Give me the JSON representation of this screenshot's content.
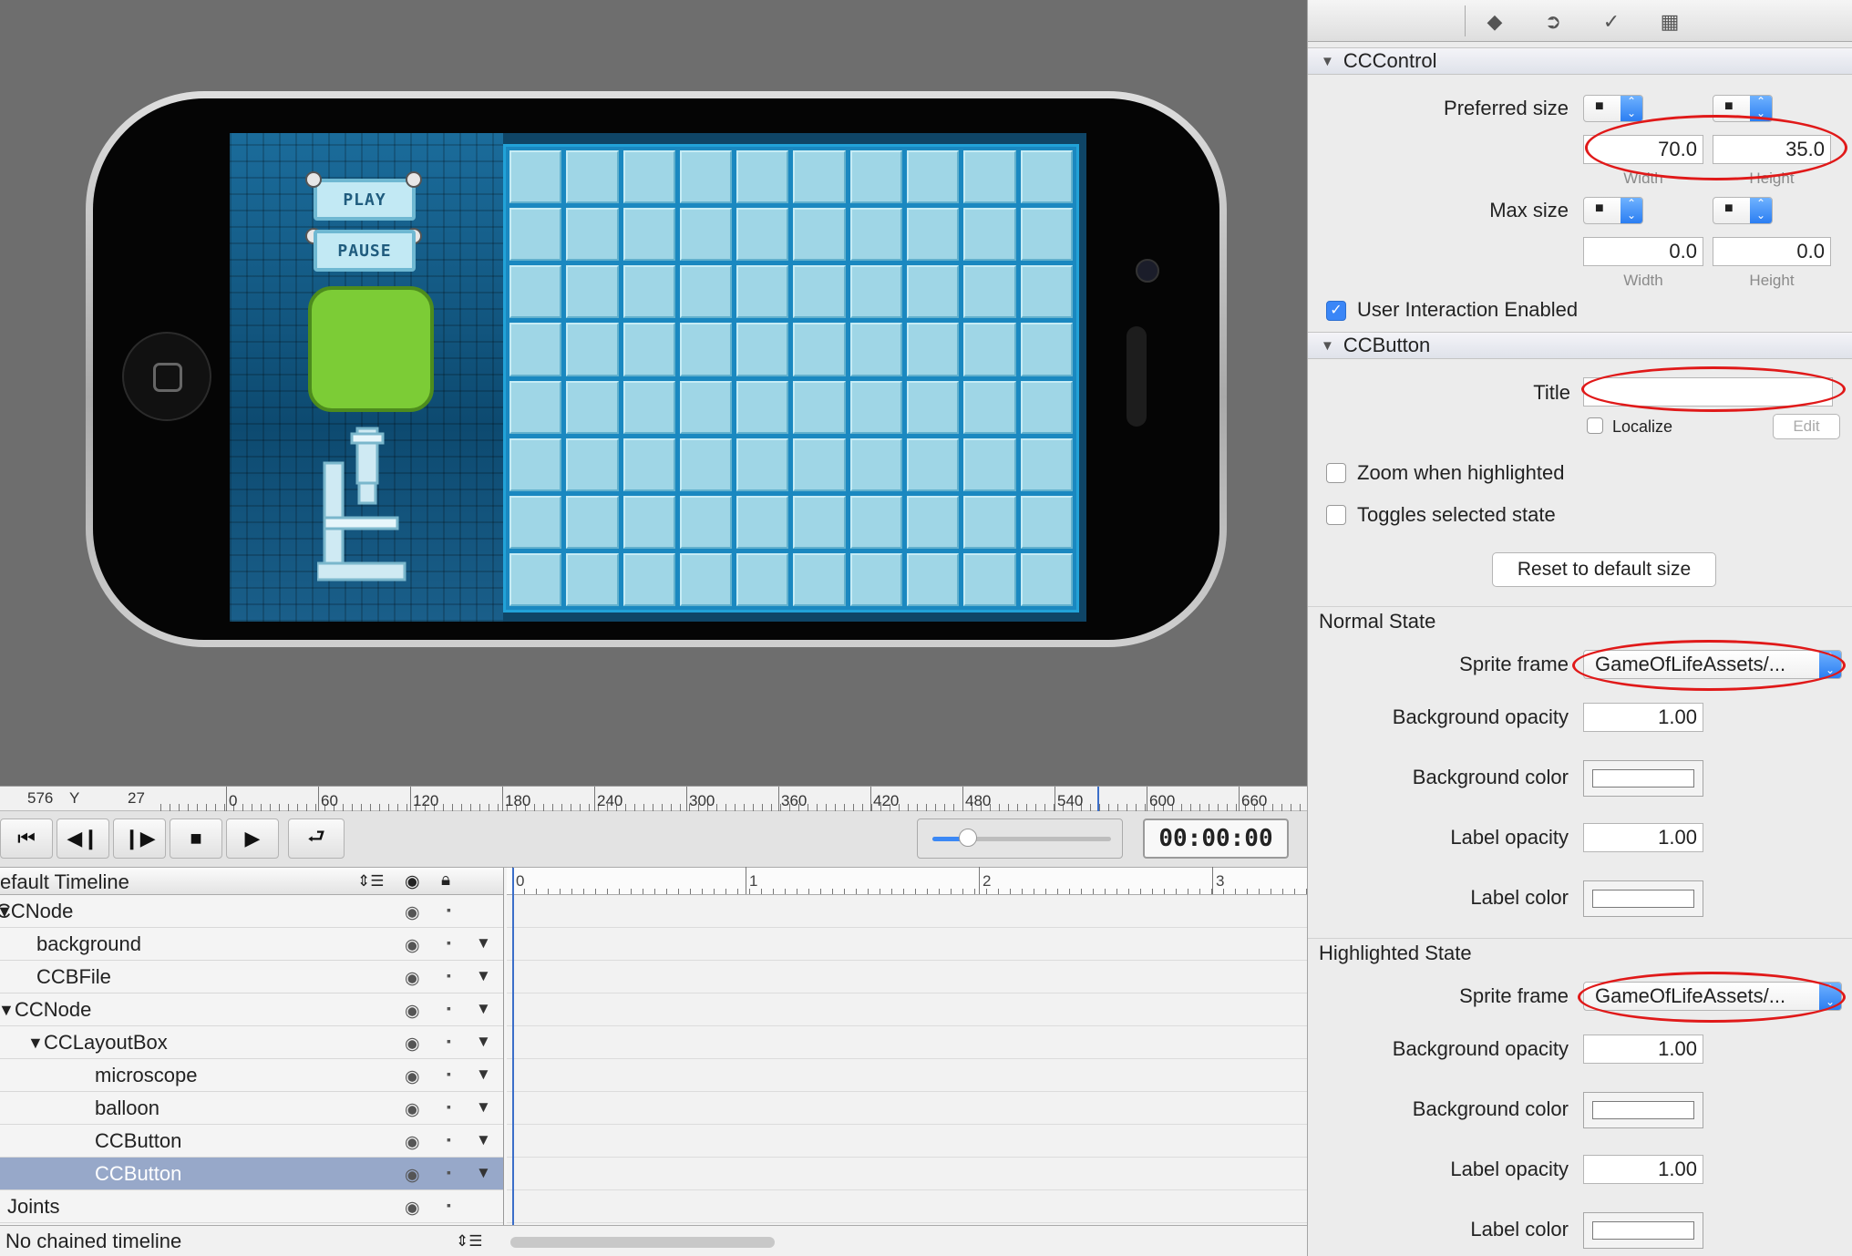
{
  "canvas": {
    "game": {
      "play_label": "PLAY",
      "pause_label": "PAUSE",
      "grid": {
        "columns": 10,
        "rows": 8
      }
    }
  },
  "ruler": {
    "coord_x": "576",
    "coord_y_label": "Y",
    "coord_y": "27",
    "ticks": [
      "0",
      "60",
      "120",
      "180",
      "240",
      "300",
      "360",
      "420",
      "480",
      "540",
      "600",
      "660"
    ]
  },
  "playback": {
    "buttons": [
      {
        "name": "go-to-start",
        "glyph": "⏮"
      },
      {
        "name": "step-back",
        "glyph": "◀❙"
      },
      {
        "name": "step-forward",
        "glyph": "❙▶"
      },
      {
        "name": "stop",
        "glyph": "■"
      },
      {
        "name": "play",
        "glyph": "▶"
      }
    ],
    "loop_glyph": "⮐",
    "scrub_level": 0.2,
    "timecode": "00:00:00"
  },
  "timeline": {
    "header": "efault Timeline",
    "header_menu_glyph": "⇕☰",
    "track_ticks": [
      "0",
      "1",
      "2",
      "3"
    ],
    "rows": [
      {
        "label": "CCNode",
        "expander": "▼",
        "has_keyframe": false,
        "selected": false
      },
      {
        "label": "background",
        "expander": "",
        "has_keyframe": true,
        "selected": false
      },
      {
        "label": "CCBFile",
        "expander": "",
        "has_keyframe": true,
        "selected": false
      },
      {
        "label": "CCNode",
        "expander": "▼",
        "has_keyframe": true,
        "selected": false
      },
      {
        "label": "CCLayoutBox",
        "expander": "▼",
        "has_keyframe": true,
        "selected": false
      },
      {
        "label": "microscope",
        "expander": "",
        "has_keyframe": true,
        "selected": false
      },
      {
        "label": "balloon",
        "expander": "",
        "has_keyframe": true,
        "selected": false
      },
      {
        "label": "CCButton",
        "expander": "",
        "has_keyframe": true,
        "selected": false
      },
      {
        "label": "CCButton",
        "expander": "",
        "has_keyframe": true,
        "selected": true
      },
      {
        "label": "Joints",
        "expander": "",
        "has_keyframe": false,
        "selected": false
      }
    ],
    "footer": "No chained timeline",
    "footer_menu_glyph": "⇕☰"
  },
  "inspector": {
    "tabs": [
      "◆",
      "➲",
      "✓",
      "▦"
    ],
    "cccontrol": {
      "title": "CCControl",
      "preferred_size_label": "Preferred size",
      "pref_width": "70.0",
      "pref_height": "35.0",
      "width_caption": "Width",
      "height_caption": "Height",
      "max_size_label": "Max size",
      "max_width": "0.0",
      "max_height": "0.0",
      "user_interaction_label": "User Interaction Enabled",
      "user_interaction_checked": true
    },
    "ccbutton": {
      "title": "CCButton",
      "title_label": "Title",
      "title_value": "",
      "localize_label": "Localize",
      "edit_label": "Edit",
      "zoom_label": "Zoom when highlighted",
      "toggles_label": "Toggles selected state",
      "reset_label": "Reset to default size"
    },
    "normal_state": {
      "title": "Normal State",
      "sprite_label": "Sprite frame",
      "sprite_value": "GameOfLifeAssets/...",
      "bg_opacity_label": "Background opacity",
      "bg_opacity": "1.00",
      "bg_color_label": "Background color",
      "label_opacity_label": "Label opacity",
      "label_opacity": "1.00",
      "label_color_label": "Label color"
    },
    "highlighted_state": {
      "title": "Highlighted State",
      "sprite_label": "Sprite frame",
      "sprite_value": "GameOfLifeAssets/...",
      "bg_opacity_label": "Background opacity",
      "bg_opacity": "1.00",
      "bg_color_label": "Background color",
      "label_opacity_label": "Label opacity",
      "label_opacity": "1.00",
      "label_color_label": "Label color"
    },
    "colors": {
      "annotation": "#e01919",
      "accent": "#3a86f7",
      "selection": "#97a8c9"
    }
  }
}
